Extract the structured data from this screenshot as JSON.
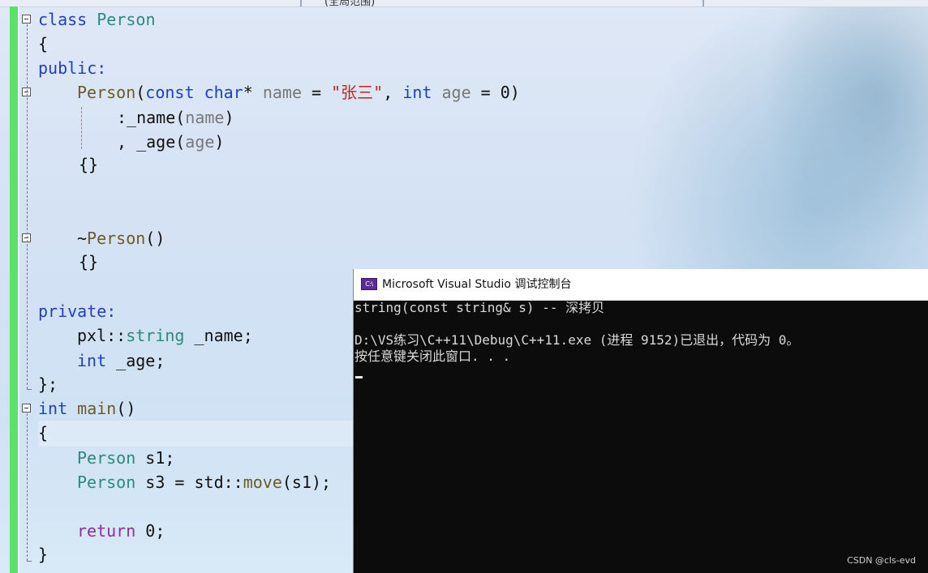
{
  "editor": {
    "tab_fragment": "(全局范围)",
    "lines": {
      "l1": {
        "kw": "class",
        "name": "Person"
      },
      "l2": "{",
      "l3": "public:",
      "l4": {
        "ctor": "Person",
        "open": "(",
        "const": "const",
        "char": "char",
        "star": "* ",
        "param1": "name",
        "eq": " = ",
        "str": "\"张三\"",
        "comma": ", ",
        "int": "int",
        "param2": "age",
        "rest": " = 0)"
      },
      "l5": {
        "prefix": ":_name(",
        "arg": "name",
        "suffix": ")"
      },
      "l6": {
        "prefix": ", _age(",
        "arg": "age",
        "suffix": ")"
      },
      "l7": "{}",
      "l8": {
        "tilde": "~",
        "name": "Person",
        "rest": "()"
      },
      "l9": "{}",
      "l10": "private:",
      "l11": {
        "ns": "pxl",
        "sep": "::",
        "type": "string",
        "rest": " _name;"
      },
      "l12": {
        "type": "int",
        "rest": " _age;"
      },
      "l13": "};",
      "l14": {
        "type": "int",
        "name": "main",
        "rest": "()"
      },
      "l15": "{",
      "l16": {
        "type": "Person",
        "rest": " s1;"
      },
      "l17": {
        "type": "Person",
        "mid": " s3 = std::",
        "fn": "move",
        "rest": "(s1);"
      },
      "l18": {
        "kw": "return",
        "rest": " 0;"
      },
      "l19": "}"
    }
  },
  "console": {
    "title": "Microsoft Visual Studio 调试控制台",
    "icon_text": "C:\\",
    "lines": [
      "string(const string& s) -- 深拷贝",
      "",
      "D:\\VS练习\\C++11\\Debug\\C++11.exe (进程 9152)已退出，代码为 0。",
      "按任意键关闭此窗口. . ."
    ]
  },
  "watermark": "CSDN @cls-evd",
  "colors": {
    "keyword": "#1f3fbf",
    "type": "#2b8a7e",
    "string": "#c82020",
    "control": "#8d2aa8",
    "change_bar": "#5ee06a"
  }
}
